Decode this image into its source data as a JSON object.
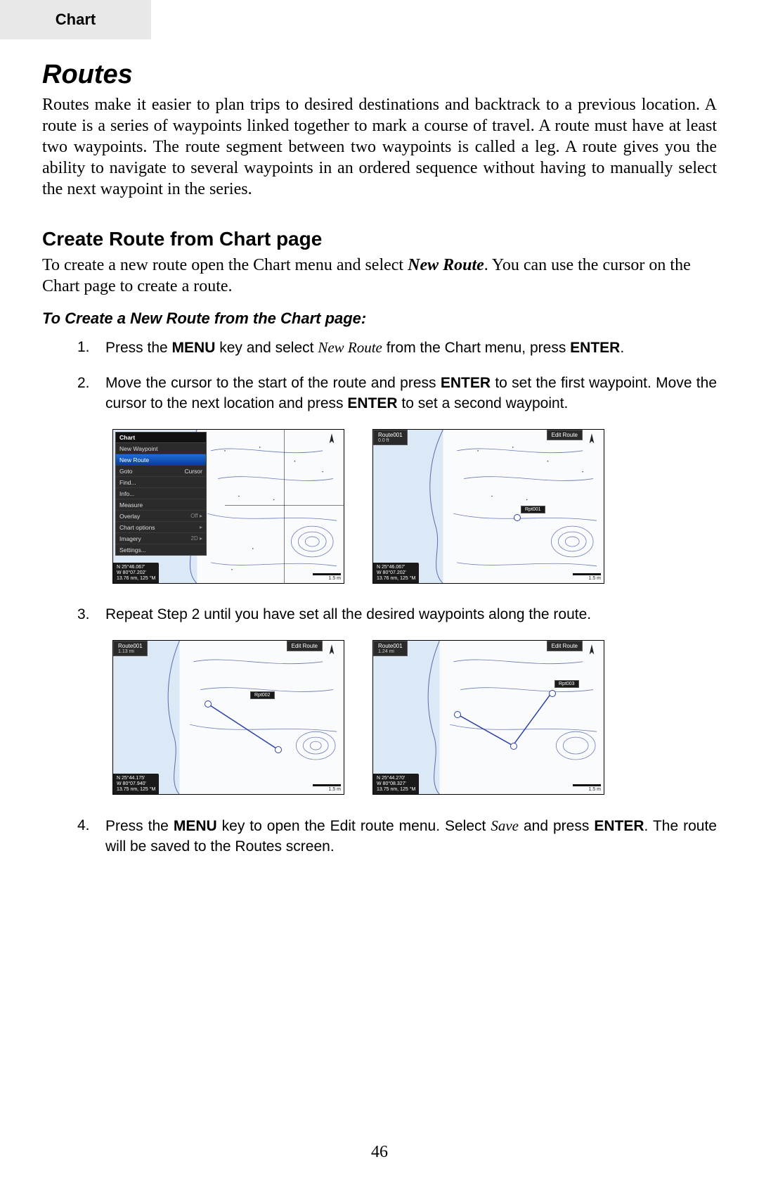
{
  "tab": {
    "label": "Chart"
  },
  "title": "Routes",
  "intro": "Routes make it easier to plan trips to desired destinations and backtrack to a previous location. A route is a series of waypoints linked together to mark a course of travel. A route must have at least two waypoints. The route segment between two waypoints is called a leg. A route gives you the ability to navigate to several waypoints in an ordered sequence without having to manually select the next waypoint in the series.",
  "section": {
    "heading": "Create Route from Chart page",
    "body_pre": "To create a new route open the Chart menu and select ",
    "body_em": "New Route",
    "body_post": ". You can use the cursor on the Chart page to create a route.",
    "steps_heading": "To Create a New Route from the Chart page:",
    "steps": [
      {
        "n": "1.",
        "html": "Press the <b>MENU</b> key and select <i>New Route</i> from the Chart menu, press <b>ENTER</b>."
      },
      {
        "n": "2.",
        "html": "Move the cursor to the start of the route and press <b>ENTER</b> to set the first waypoint. Move the cursor to the next location and press <b>ENTER</b> to set a second waypoint."
      },
      {
        "n": "3.",
        "html": "Repeat Step 2 until you have set all the desired waypoints along the route."
      },
      {
        "n": "4.",
        "html": "Press the <b>MENU</b> key to open the Edit route menu. Select <i>Save</i> and press <b>ENTER</b>. The route will be saved to the Routes screen."
      }
    ]
  },
  "fig1": {
    "menu_title": "Chart",
    "menu_items": [
      {
        "label": "New Waypoint"
      },
      {
        "label": "New Route",
        "selected": true
      },
      {
        "label": "Goto",
        "right": "Cursor"
      },
      {
        "label": "Find..."
      },
      {
        "label": "Info..."
      },
      {
        "label": "Measure"
      },
      {
        "label": "Overlay",
        "right": "Off",
        "caret": true
      },
      {
        "label": "Chart options",
        "caret": true
      },
      {
        "label": "Imagery",
        "right": "2D",
        "caret": true
      },
      {
        "label": "Settings..."
      }
    ],
    "coords": {
      "lat": "N  25°46.067'",
      "lon": "W  80°07.202'",
      "info": "13.76 nm, 125 °M"
    },
    "scale": "1.5 m"
  },
  "fig2": {
    "header_left": {
      "title": "Route001",
      "sub": "0.0 ft"
    },
    "header_right": "Edit Route",
    "wp_label": "Rpt001",
    "coords": {
      "lat": "N  25°46.067'",
      "lon": "W  80°07.202'",
      "info": "13.76 nm, 125 °M"
    },
    "scale": "1.5 m"
  },
  "fig3": {
    "header_left": {
      "title": "Route001",
      "sub": "1.13 mi"
    },
    "header_right": "Edit Route",
    "wp_label": "Rpt002",
    "coords": {
      "lat": "N  25°44.175'",
      "lon": "W  80°07.940'",
      "info": "13.75 nm, 125 °M"
    },
    "scale": "1.5 m"
  },
  "fig4": {
    "header_left": {
      "title": "Route001",
      "sub": "1.24 mi"
    },
    "header_right": "Edit Route",
    "wp_label": "Rpt003",
    "coords": {
      "lat": "N  25°44.270'",
      "lon": "W  80°08.327'",
      "info": "13.75 nm, 125 °M"
    },
    "scale": "1.5 m"
  },
  "page_number": "46"
}
